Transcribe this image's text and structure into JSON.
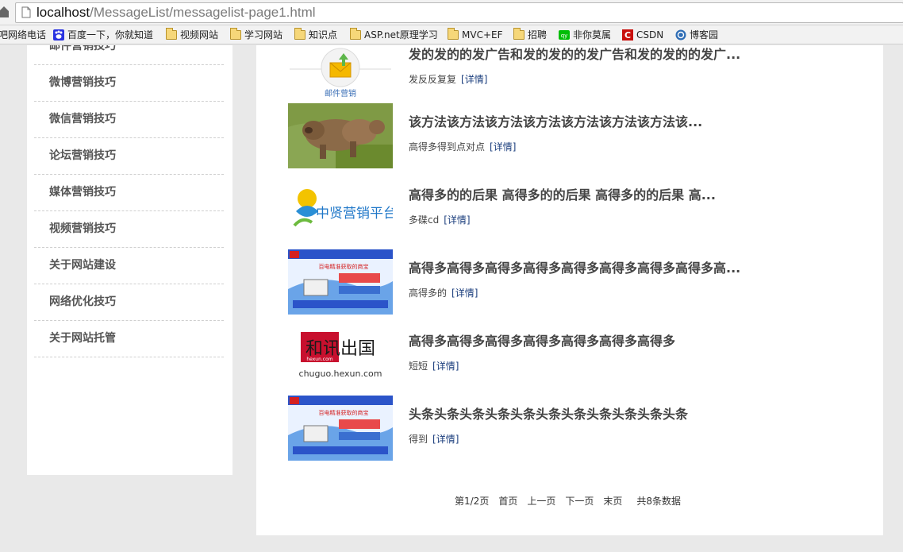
{
  "browser": {
    "url_host": "localhost",
    "url_path": "/MessageList/messagelist-page1.html",
    "bookmarks": [
      {
        "label": "吧网络电话",
        "icon": "none"
      },
      {
        "label": "百度一下，你就知道",
        "icon": "baidu-paw-icon"
      },
      {
        "label": "视频网站",
        "icon": "folder-icon"
      },
      {
        "label": "学习网站",
        "icon": "folder-icon"
      },
      {
        "label": "知识点",
        "icon": "folder-icon"
      },
      {
        "label": "ASP.net原理学习",
        "icon": "folder-icon"
      },
      {
        "label": "MVC+EF",
        "icon": "folder-icon"
      },
      {
        "label": "招聘",
        "icon": "folder-icon"
      },
      {
        "label": "非你莫属",
        "icon": "iqiyi-icon"
      },
      {
        "label": "CSDN",
        "icon": "csdn-icon"
      },
      {
        "label": "博客园",
        "icon": "cnblogs-icon"
      }
    ]
  },
  "sidebar": {
    "items": [
      {
        "label": "邮件营销技巧"
      },
      {
        "label": "微博营销技巧"
      },
      {
        "label": "微信营销技巧"
      },
      {
        "label": "论坛营销技巧"
      },
      {
        "label": "媒体营销技巧"
      },
      {
        "label": "视频营销技巧"
      },
      {
        "label": "关于网站建设"
      },
      {
        "label": "网络优化技巧"
      },
      {
        "label": "关于网站托管"
      }
    ]
  },
  "news": [
    {
      "title": "发的发的的发广告和发的发的的发广告和发的发的的发广...",
      "desc": "发反反复复",
      "more": "[详情]",
      "thumb": "email-marketing-icon",
      "thumb_caption": "邮件营销"
    },
    {
      "title": "该方法该方法该方法该方法该方法该方法该方法该...",
      "desc": "高得多得到点对点",
      "more": "[详情]",
      "thumb": "bears-photo"
    },
    {
      "title": "高得多的的后果 高得多的的后果 高得多的的后果 高...",
      "desc": "多碟cd",
      "more": "[详情]",
      "thumb": "zhongxian-logo",
      "thumb_text": "中贤营销平台"
    },
    {
      "title": "高得多高得多高得多高得多高得多高得多高得多高得多高...",
      "desc": "高得多的",
      "more": "[详情]",
      "thumb": "yunhui-banner",
      "banner_text": "百电精准获取的商宝"
    },
    {
      "title": "高得多高得多高得多高得多高得多高得多高得多",
      "desc": "短短",
      "more": "[详情]",
      "thumb": "hexun-logo",
      "thumb_text": "和讯出国",
      "thumb_sub": "chuguo.hexun.com",
      "thumb_small": "hexun.com"
    },
    {
      "title": "头条头条头条头条头条头条头条头条头条头条头条",
      "desc": "得到",
      "more": "[详情]",
      "thumb": "yunhui-banner",
      "banner_text": "百电精准获取的商宝"
    }
  ],
  "pager": {
    "status": "第1/2页",
    "first": "首页",
    "prev": "上一页",
    "next": "下一页",
    "last": "末页",
    "total": "共8条数据"
  }
}
